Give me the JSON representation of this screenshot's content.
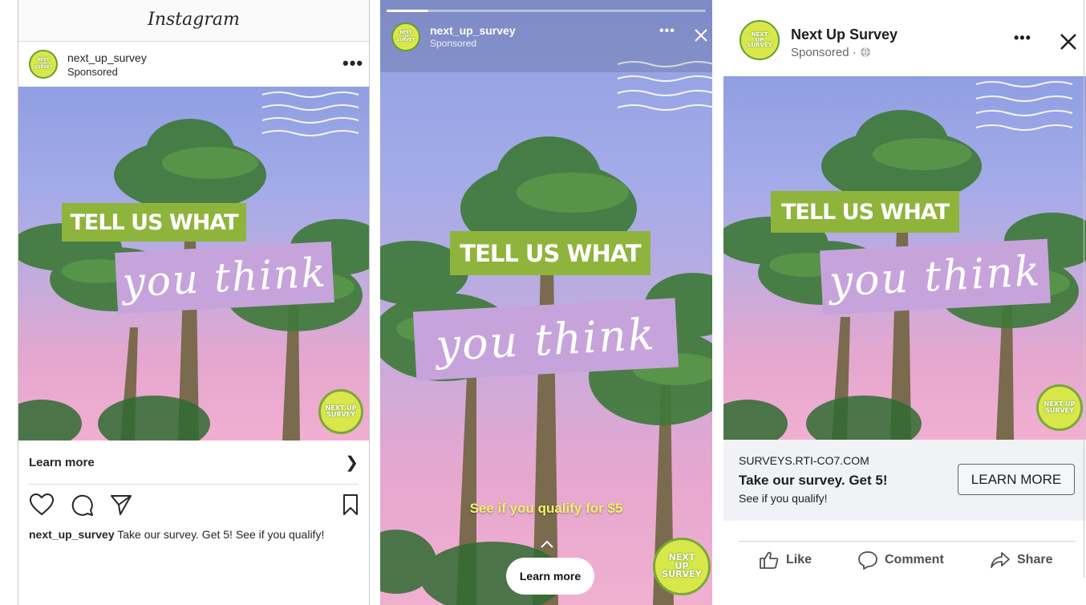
{
  "ad": {
    "banner_top": "TELL US WHAT",
    "banner_bottom": "you think",
    "logo_text": "NEXT UP SURVEY"
  },
  "instagram": {
    "app_title": "Instagram",
    "username": "next_up_survey",
    "sponsored_label": "Sponsored",
    "more_icon": "more-horizontal-icon",
    "cta_label": "Learn more",
    "cta_icon": "chevron-right-icon",
    "action_icons": [
      "heart-icon",
      "comment-icon",
      "share-icon",
      "bookmark-icon"
    ],
    "caption_user": "next_up_survey",
    "caption_text": "Take our survey. Get 5! See if you qualify!"
  },
  "story": {
    "username": "next_up_survey",
    "sponsored_label": "Sponsored",
    "progress": 0.13,
    "tagline": "See if you qualify for $5",
    "cta_label": "Learn more",
    "cta_icon": "chevron-up-icon",
    "header_icons": [
      "more-horizontal-icon",
      "close-icon"
    ]
  },
  "facebook": {
    "page_name": "Next Up Survey",
    "sponsored_label": "Sponsored · ",
    "privacy_icon": "globe-icon",
    "close_icon": "close-icon",
    "more_icon": "more-horizontal-icon",
    "link_domain": "SURVEYS.RTI-CO7.COM",
    "link_headline": "Take our survey. Get 5!",
    "link_description": "See if you qualify!",
    "cta_label": "LEARN MORE",
    "actions": [
      {
        "label": "Like",
        "icon": "thumbs-up-icon"
      },
      {
        "label": "Comment",
        "icon": "comment-icon"
      },
      {
        "label": "Share",
        "icon": "share-icon"
      }
    ]
  },
  "colors": {
    "banner_green": "#8fb43c",
    "banner_purple": "#c7a3dc",
    "logo_yellow": "#d8e84a",
    "tagline_yellow": "#f1f26a"
  }
}
